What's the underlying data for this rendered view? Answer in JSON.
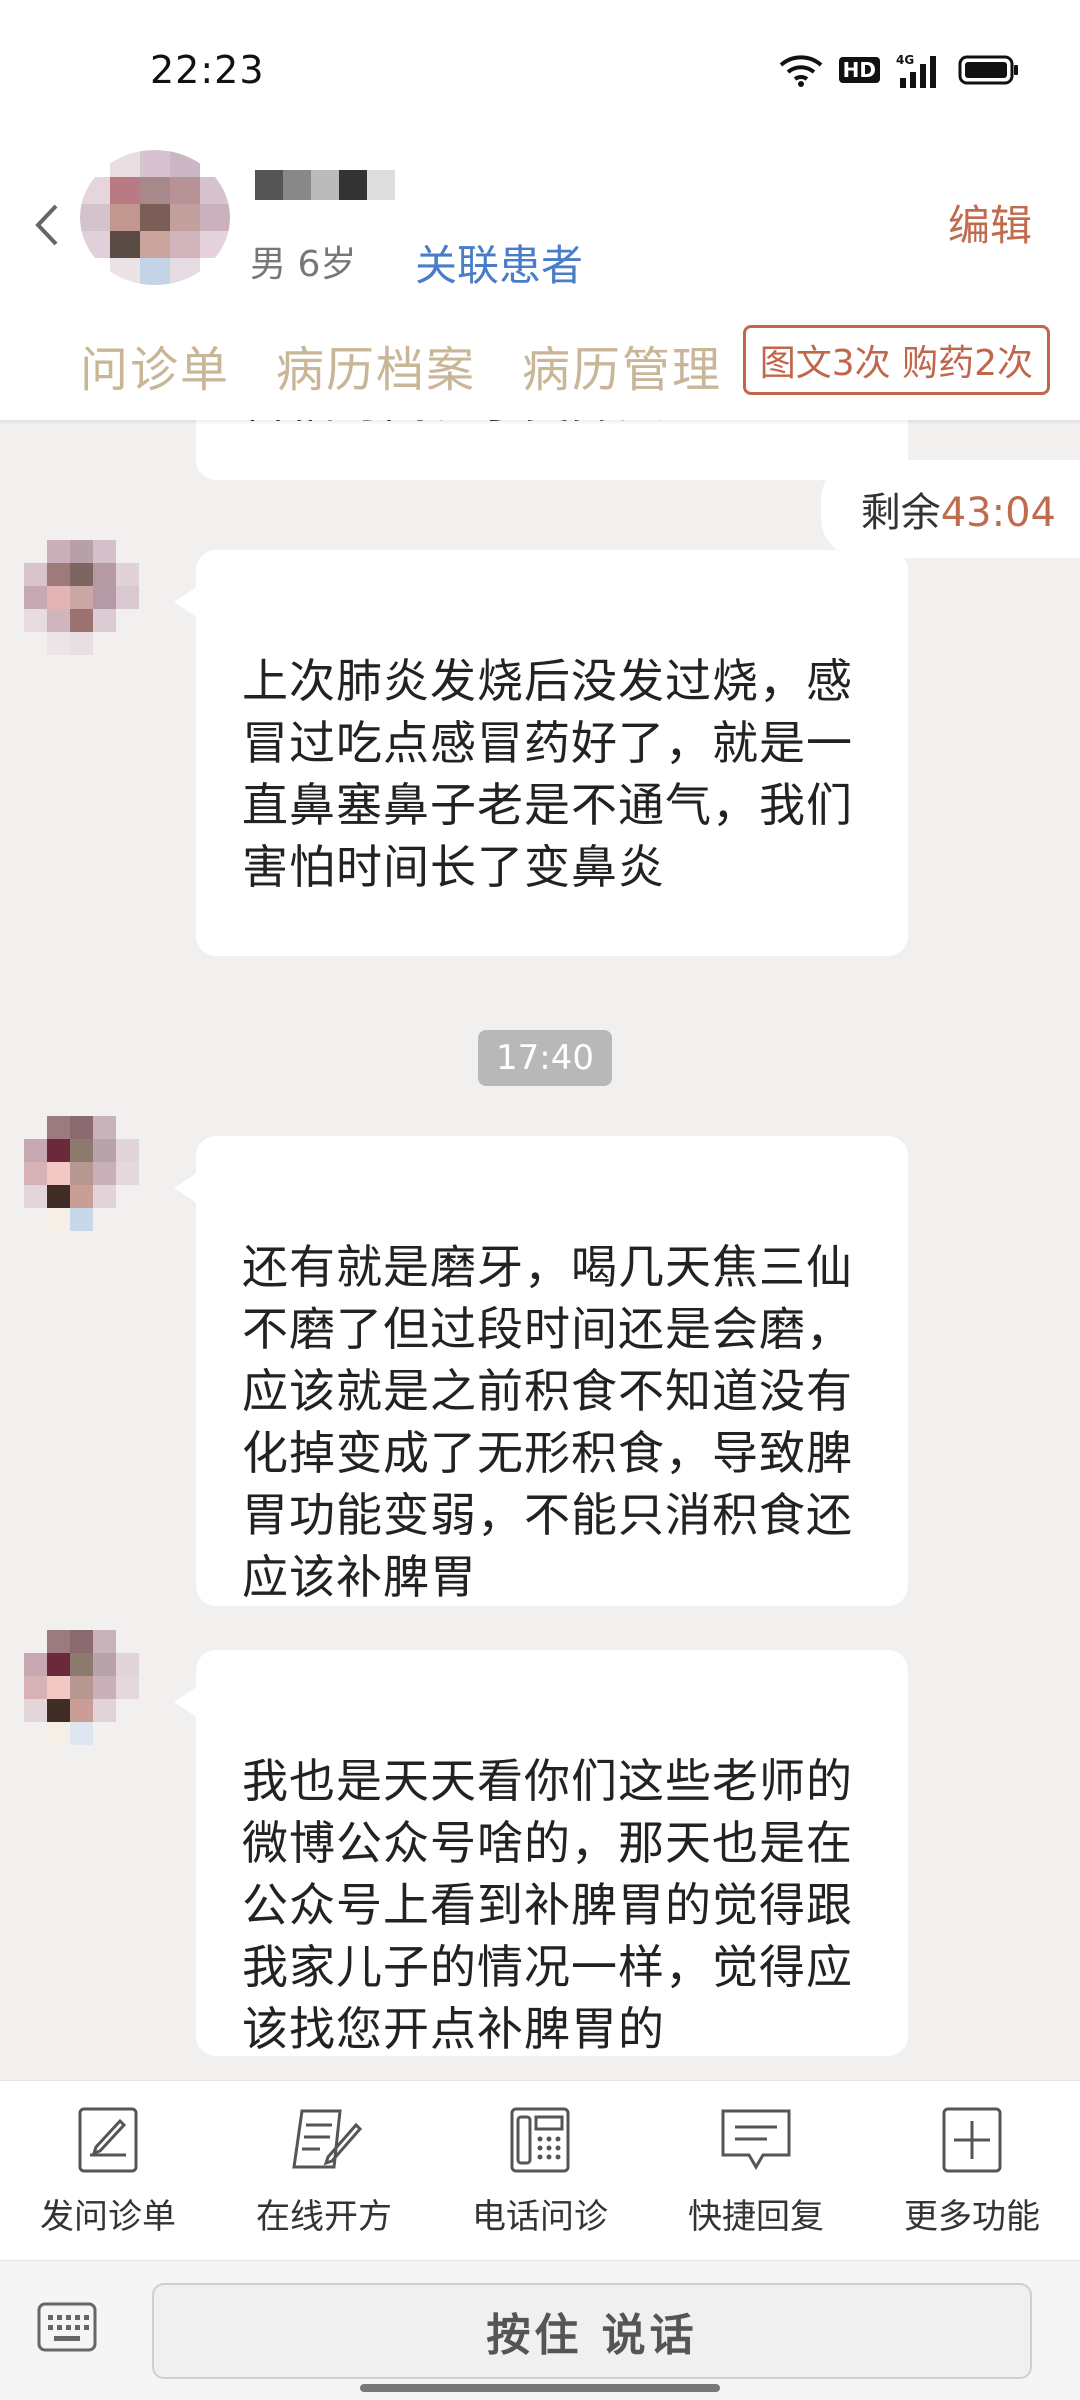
{
  "status_bar": {
    "time": "22:23",
    "hd_label": "HD",
    "network_label": "4G"
  },
  "header": {
    "patient_meta": "男 6岁",
    "link_patient": "关联患者",
    "edit": "编辑",
    "tabs": [
      "问诊单",
      "病历档案",
      "病历管理"
    ],
    "quota": "图文3次 购药2次"
  },
  "chat": {
    "fragment_text": "害怕时间长了变鼻炎",
    "remaining_label": "剩余",
    "remaining_time": "43:04",
    "time_divider": "17:40",
    "messages": [
      {
        "text": "上次肺炎发烧后没发过烧，感冒过吃点感冒药好了，就是一直鼻塞鼻子老是不通气，我们害怕时间长了变鼻炎"
      },
      {
        "text": "还有就是磨牙，喝几天焦三仙不磨了但过段时间还是会磨，应该就是之前积食不知道没有化掉变成了无形积食，导致脾胃功能变弱，不能只消积食还应该补脾胃"
      },
      {
        "text": "我也是天天看你们这些老师的微博公众号啥的，那天也是在公众号上看到补脾胃的觉得跟我家儿子的情况一样，觉得应该找您开点补脾胃的"
      }
    ]
  },
  "toolbar": {
    "items": [
      "发问诊单",
      "在线开方",
      "电话问诊",
      "快捷回复",
      "更多功能"
    ]
  },
  "input": {
    "hold_to_talk": "按住 说话"
  },
  "colors": {
    "accent": "#c06a4e",
    "link": "#4a7dc9",
    "tab": "#c9b697",
    "background": "#f2f0ef"
  }
}
